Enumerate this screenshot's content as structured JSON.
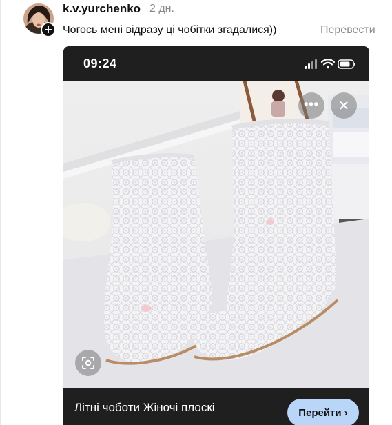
{
  "comment": {
    "username": "k.v.yurchenko",
    "timestamp": "2 дн.",
    "text": "Чогось мені відразу ці чобітки згадалися))",
    "translate_label": "Перевести",
    "follow_symbol": "+"
  },
  "screenshot": {
    "status_time": "09:24",
    "status_icons": [
      "signal-icon",
      "wifi-icon",
      "battery-icon"
    ],
    "overlay_more_symbol": "•••",
    "overlay_close_symbol": "✕",
    "caption": "Літні чоботи Жіночі плоскі",
    "go_button_label": "Перейти ›"
  },
  "colors": {
    "dark_bar": "#1f1f1f",
    "go_button": "#b9d5f7",
    "muted_text": "#8a8a8a"
  }
}
